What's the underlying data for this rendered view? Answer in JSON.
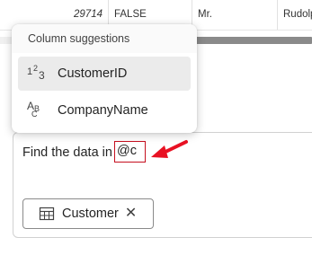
{
  "table": {
    "row": {
      "id": "29714",
      "flag": "FALSE",
      "title": "Mr.",
      "name": "Rudolph"
    }
  },
  "popup": {
    "title": "Column suggestions",
    "items": [
      {
        "label": "CustomerID",
        "icon": "number-type-icon",
        "selected": true
      },
      {
        "label": "CompanyName",
        "icon": "text-type-icon",
        "selected": false
      }
    ]
  },
  "editor": {
    "text": "Find the data in",
    "mention": "@c",
    "chip_label": "Customer"
  },
  "colors": {
    "accent_red": "#e81123",
    "mention_border": "#c50f1f"
  }
}
